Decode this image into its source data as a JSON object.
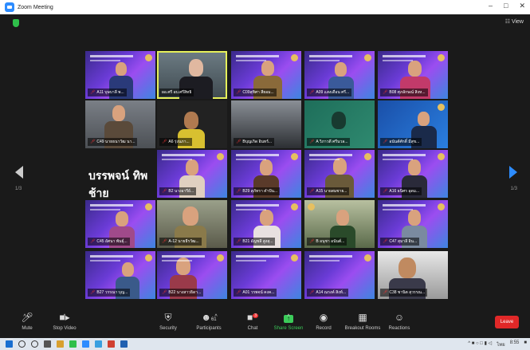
{
  "window": {
    "title": "Zoom Meeting",
    "controls": [
      "–",
      "□",
      "✕"
    ]
  },
  "view_label": "☷ View",
  "pages": {
    "left": "1/3",
    "right": "1/3"
  },
  "tiles": [
    {
      "label": "A11 บุษบาลี พ...",
      "mic": true
    },
    {
      "label": "ผอ.ศรี อบ.ศรีสิทธิ",
      "mic": false
    },
    {
      "label": "C09สุทิศา สียอม...",
      "mic": true
    },
    {
      "label": "A09 แสงเดือน ศรี...",
      "mic": true
    },
    {
      "label": "B08 ศุภลักษณ์ สิงห...",
      "mic": true
    },
    {
      "label": "C49 นายธนาวัฒ นา...",
      "mic": true
    },
    {
      "label": "A6 รุ่งนภา...",
      "mic": true
    },
    {
      "label": "Bบุญเกิด อินทร์...",
      "mic": true
    },
    {
      "label": "A วิภาวดี ศรีนวล...",
      "mic": true
    },
    {
      "label": "อนันต์ศักดิ์ มีสุข...",
      "mic": true
    },
    {
      "label": "",
      "mic": false,
      "text": "บรรพจน์ ทิพช้าย"
    },
    {
      "label": "B2 นางอารีย์...",
      "mic": true
    },
    {
      "label": "B29 สุภัทรา คำปัน...",
      "mic": true
    },
    {
      "label": "A15 นายสมชาย...",
      "mic": true
    },
    {
      "label": "A16 ธนิศร อุดม...",
      "mic": true
    },
    {
      "label": "C45 อัศนา พันธุ์...",
      "mic": true
    },
    {
      "label": "A-12 นายธีรวัฒ...",
      "mic": true
    },
    {
      "label": "B21 อัญชลี สูงสุ...",
      "mic": true
    },
    {
      "label": "B อนุชา อนันต์...",
      "mic": true
    },
    {
      "label": "C47 สุมาลี อิน...",
      "mic": true
    },
    {
      "label": "B27 วรรณา บุญ...",
      "mic": true
    },
    {
      "label": "B22 นางสาวธิดา...",
      "mic": true
    },
    {
      "label": "A01 วรพจน์ คงค...",
      "mic": true
    },
    {
      "label": "A14 ณรงค์ สิงห์...",
      "mic": true
    },
    {
      "label": "C38 ชานิต สุวรรณ...",
      "mic": true
    }
  ],
  "toolbar": {
    "mute": "Mute",
    "stop_video": "Stop Video",
    "security": "Security",
    "participants": "Participants",
    "participants_count": "61",
    "chat": "Chat",
    "chat_badge": "3",
    "share_screen": "Share Screen",
    "record": "Record",
    "breakout_rooms": "Breakout Rooms",
    "reactions": "Reactions",
    "leave": "Leave"
  },
  "taskbar": {
    "lang": "ไทย",
    "time": "8:55"
  },
  "colors": {
    "accent": "#2d8cff",
    "leave": "#e02828",
    "share": "#3ccc5a",
    "active_border": "#e6f05a"
  }
}
